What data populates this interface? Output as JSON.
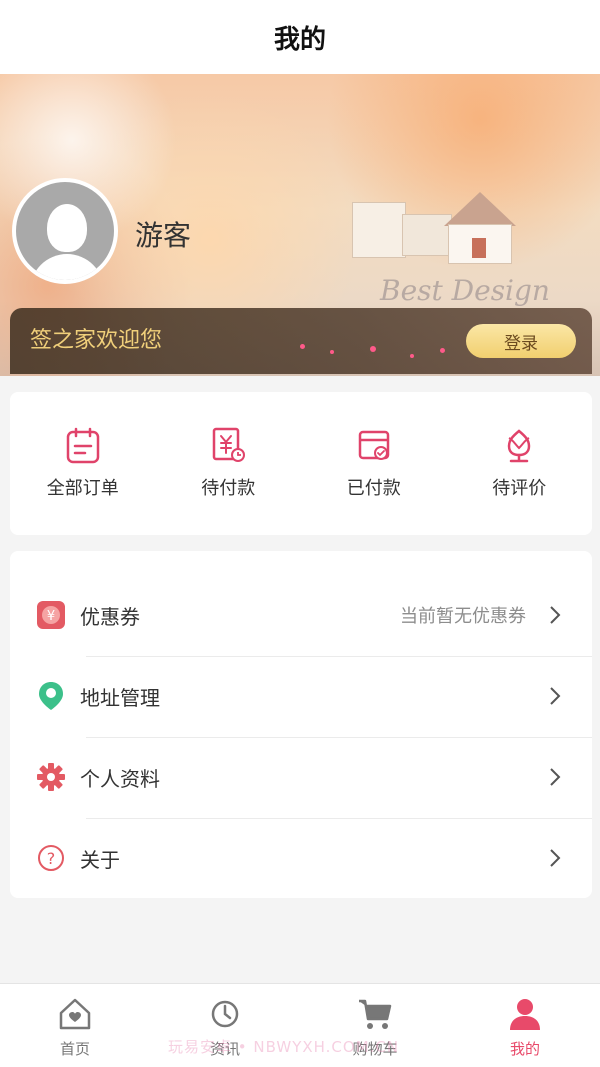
{
  "header": {
    "title": "我的"
  },
  "profile": {
    "username": "游客"
  },
  "welcome": {
    "text": "签之家欢迎您",
    "login_label": "登录"
  },
  "orders": [
    {
      "label": "全部订单",
      "icon": "all-orders-icon"
    },
    {
      "label": "待付款",
      "icon": "pending-payment-icon"
    },
    {
      "label": "已付款",
      "icon": "paid-icon"
    },
    {
      "label": "待评价",
      "icon": "pending-review-icon"
    }
  ],
  "menu": [
    {
      "label": "优惠券",
      "hint": "当前暂无优惠券",
      "icon": "coupon-icon"
    },
    {
      "label": "地址管理",
      "hint": "",
      "icon": "location-icon"
    },
    {
      "label": "个人资料",
      "hint": "",
      "icon": "gear-icon"
    },
    {
      "label": "关于",
      "hint": "",
      "icon": "question-icon"
    }
  ],
  "tabbar": [
    {
      "label": "首页",
      "icon": "home-icon",
      "active": false
    },
    {
      "label": "资讯",
      "icon": "news-icon",
      "active": false
    },
    {
      "label": "购物车",
      "icon": "cart-icon",
      "active": false
    },
    {
      "label": "我的",
      "icon": "user-icon",
      "active": true
    }
  ],
  "watermark": "玩易安卓 • NBWYXH.COM.CN",
  "colors": {
    "accent": "#e84a6a",
    "icon_pink": "#e0436a",
    "location_green": "#3cc08a",
    "gold": "#f0cf7a"
  }
}
